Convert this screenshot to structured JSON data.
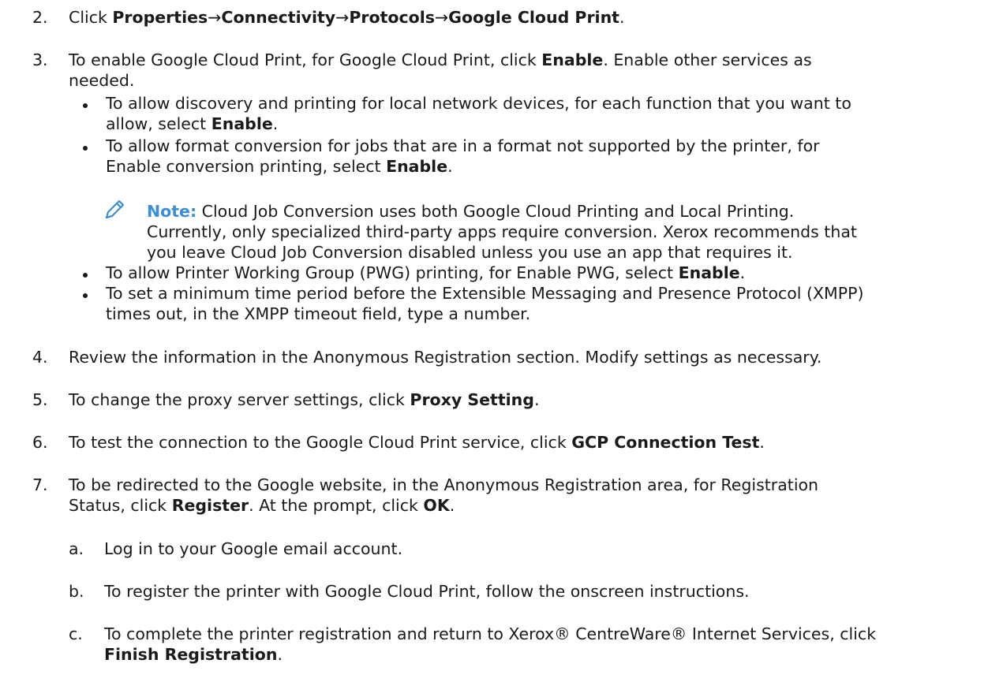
{
  "steps": {
    "s2": {
      "num": "2.",
      "t1": "Click ",
      "b1": "Properties",
      "a1": "→",
      "b2": "Connectivity",
      "a2": "→",
      "b3": "Protocols",
      "a3": "→",
      "b4": "Google Cloud Print",
      "t2": "."
    },
    "s3": {
      "num": "3.",
      "l1a": "To enable Google Cloud Print, for Google Cloud Print, click ",
      "l1b": "Enable",
      "l1c": ". Enable other services as",
      "l2": "needed."
    },
    "s4": {
      "num": "4.",
      "text": "Review the information in the Anonymous Registration section. Modify settings as necessary."
    },
    "s5": {
      "num": "5.",
      "t1": "To change the proxy server settings, click ",
      "b1": "Proxy Setting",
      "t2": "."
    },
    "s6": {
      "num": "6.",
      "t1": "To test the connection to the Google Cloud Print service, click ",
      "b1": "GCP Connection Test",
      "t2": "."
    },
    "s7": {
      "num": "7.",
      "l1": "To be redirected to the Google website, in the Anonymous Registration area, for Registration",
      "l2a": "Status, click ",
      "l2b": "Register",
      "l2c": ". At the prompt, click ",
      "l2d": "OK",
      "l2e": "."
    }
  },
  "bullets": {
    "b1": {
      "l1": "To allow discovery and printing for local network devices, for each function that you want to",
      "l2a": "allow, select ",
      "l2b": "Enable",
      "l2c": "."
    },
    "b2": {
      "l1": "To allow format conversion for jobs that are in a format not supported by the printer, for",
      "l2a": "Enable conversion printing, select ",
      "l2b": "Enable",
      "l2c": "."
    },
    "b3": {
      "t1": "To allow Printer Working Group (PWG) printing, for Enable PWG, select ",
      "b1": "Enable",
      "t2": "."
    },
    "b4": {
      "l1": "To set a minimum time period before the Extensible Messaging and Presence Protocol (XMPP)",
      "l2": "times out, in the XMPP timeout field, type a number."
    }
  },
  "note": {
    "label": "Note:",
    "l1": " Cloud Job Conversion uses both Google Cloud Printing and Local Printing.",
    "l2": "Currently, only specialized third-party apps require conversion. Xerox recommends that",
    "l3": "you leave Cloud Job Conversion disabled unless you use an app that requires it.",
    "icon": "pencil-icon",
    "icon_color": "#3a8ed8"
  },
  "substeps": {
    "a": {
      "num": "a.",
      "text": "Log in to your Google email account."
    },
    "b": {
      "num": "b.",
      "text": "To register the printer with Google Cloud Print, follow the onscreen instructions."
    },
    "c": {
      "num": "c.",
      "l1": "To complete the printer registration and return to Xerox® CentreWare® Internet Services, click",
      "l2a": "Finish Registration",
      "l2b": "."
    }
  }
}
